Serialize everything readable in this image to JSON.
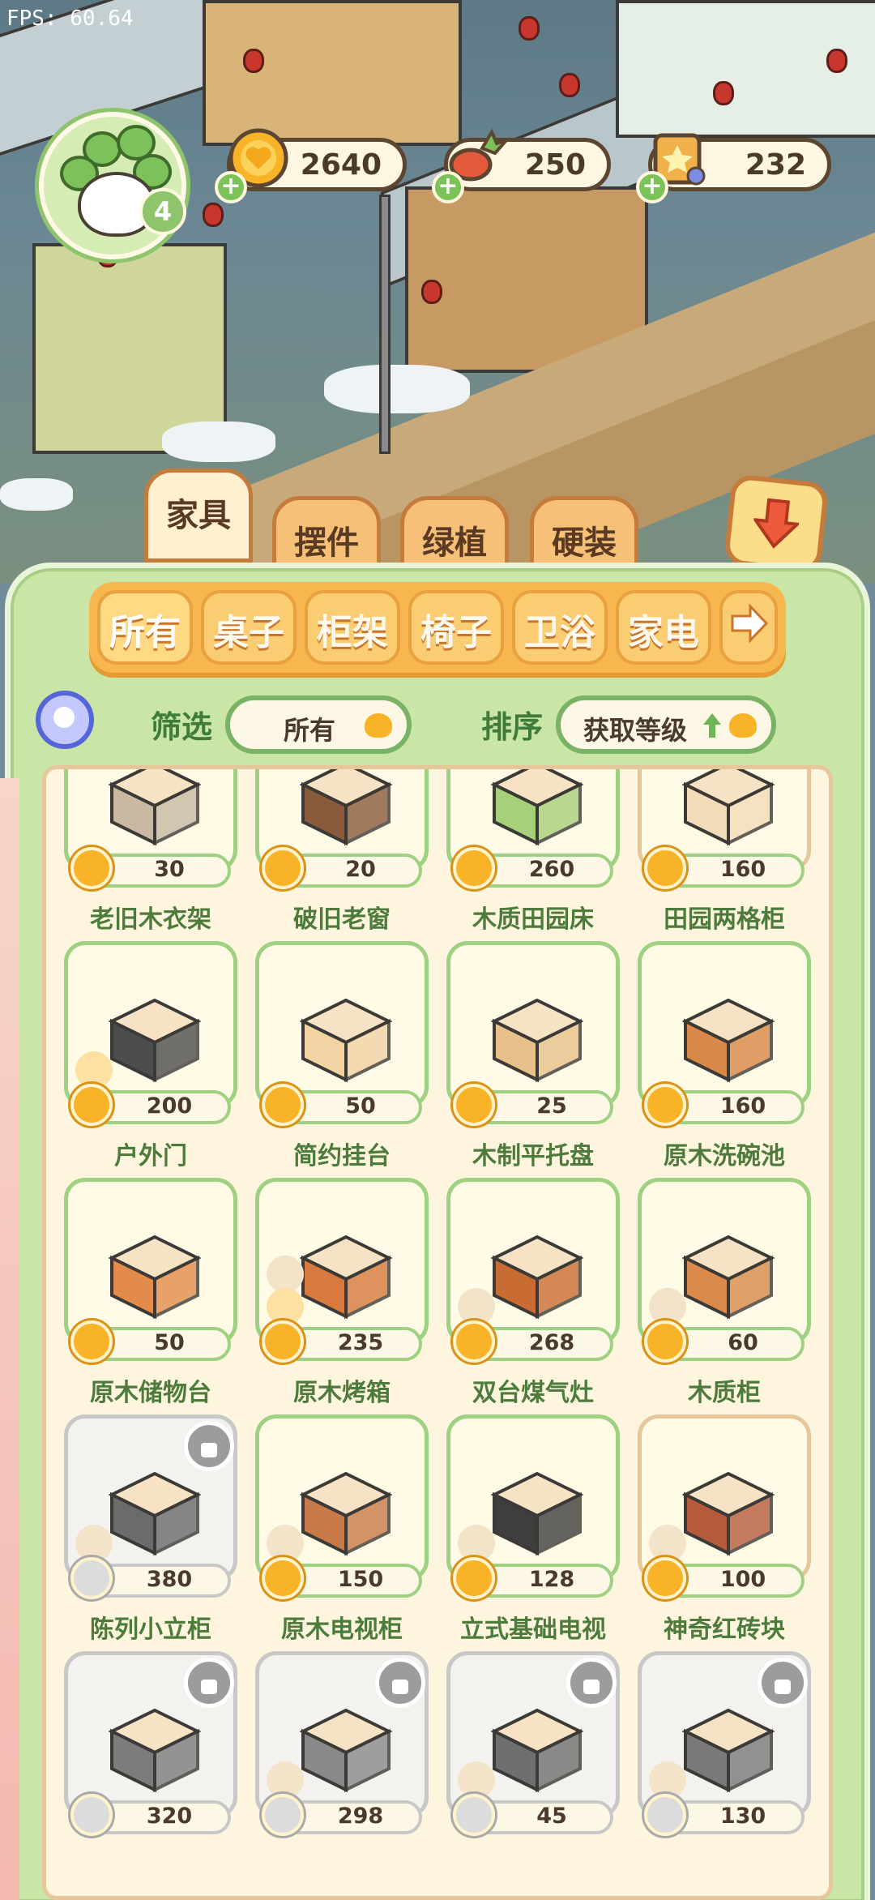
{
  "fps": "FPS: 60.64",
  "player": {
    "level": "4"
  },
  "resources": [
    {
      "value": "2640",
      "icon": "gold-coin-icon"
    },
    {
      "value": "250",
      "icon": "carrot-icon"
    },
    {
      "value": "232",
      "icon": "scroll-gem-icon"
    }
  ],
  "category_tabs": [
    "家具",
    "摆件",
    "绿植",
    "硬装"
  ],
  "active_category": "家具",
  "sub_tabs": [
    "所有",
    "桌子",
    "柜架",
    "椅子",
    "卫浴",
    "家电"
  ],
  "filter": {
    "label": "筛选",
    "value": "所有"
  },
  "sort": {
    "label": "排序",
    "value": "获取等级"
  },
  "items": [
    {
      "name": "老旧木衣架",
      "price": "30",
      "locked": false
    },
    {
      "name": "破旧老窗",
      "price": "20",
      "locked": false
    },
    {
      "name": "木质田园床",
      "price": "260",
      "locked": false
    },
    {
      "name": "田园两格柜",
      "price": "160",
      "locked": false
    },
    {
      "name": "户外门",
      "price": "200",
      "locked": false
    },
    {
      "name": "简约挂台",
      "price": "50",
      "locked": false
    },
    {
      "name": "木制平托盘",
      "price": "25",
      "locked": false
    },
    {
      "name": "原木洗碗池",
      "price": "160",
      "locked": false
    },
    {
      "name": "原木储物台",
      "price": "50",
      "locked": false
    },
    {
      "name": "原木烤箱",
      "price": "235",
      "locked": false
    },
    {
      "name": "双台煤气灶",
      "price": "268",
      "locked": false
    },
    {
      "name": "木质柜",
      "price": "60",
      "locked": false
    },
    {
      "name": "陈列小立柜",
      "price": "380",
      "locked": true
    },
    {
      "name": "原木电视柜",
      "price": "150",
      "locked": false
    },
    {
      "name": "立式基础电视",
      "price": "128",
      "locked": false
    },
    {
      "name": "神奇红砖块",
      "price": "100",
      "locked": false
    },
    {
      "name": "",
      "price": "320",
      "locked": true
    },
    {
      "name": "",
      "price": "298",
      "locked": true
    },
    {
      "name": "",
      "price": "45",
      "locked": true
    },
    {
      "name": "",
      "price": "130",
      "locked": true
    }
  ],
  "colors": {
    "panel": "#c9e6a6",
    "tab_orange": "#f8b64f",
    "text_green": "#4c7b3b",
    "coin": "#f8b329"
  }
}
